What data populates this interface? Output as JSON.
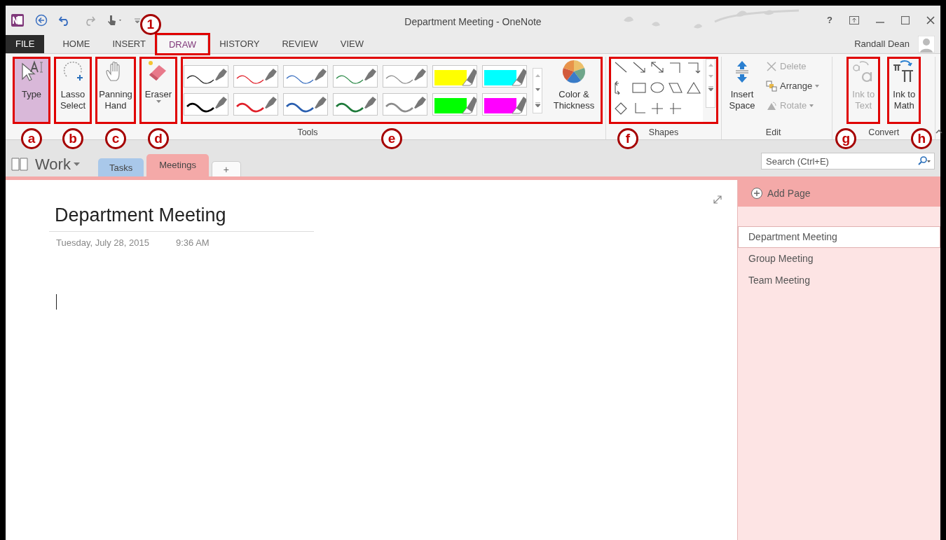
{
  "window": {
    "title": "Department Meeting - OneNote",
    "help_glyph": "?",
    "user": "Randall Dean"
  },
  "ribbon_tabs": [
    {
      "label": "FILE",
      "kind": "file",
      "selected": false
    },
    {
      "label": "HOME",
      "kind": "tab",
      "selected": false
    },
    {
      "label": "INSERT",
      "kind": "tab",
      "selected": false
    },
    {
      "label": "DRAW",
      "kind": "tab",
      "selected": true,
      "callout": "1"
    },
    {
      "label": "HISTORY",
      "kind": "tab",
      "selected": false
    },
    {
      "label": "REVIEW",
      "kind": "tab",
      "selected": false
    },
    {
      "label": "VIEW",
      "kind": "tab",
      "selected": false
    }
  ],
  "tool_buttons": [
    {
      "label": "Type",
      "kind": "type",
      "selected": true,
      "callout": "a"
    },
    {
      "label": "Lasso Select",
      "kind": "lasso",
      "selected": false,
      "callout": "b"
    },
    {
      "label": "Panning Hand",
      "kind": "hand",
      "selected": false,
      "callout": "c"
    },
    {
      "label": "Eraser",
      "kind": "eraser",
      "selected": false,
      "callout": "d"
    }
  ],
  "pens": {
    "callout": "e",
    "items": [
      {
        "kind": "thin",
        "color": "#222222"
      },
      {
        "kind": "thin",
        "color": "#e0202a"
      },
      {
        "kind": "thin",
        "color": "#3a6fc0"
      },
      {
        "kind": "thin",
        "color": "#2e8b4a"
      },
      {
        "kind": "thin",
        "color": "#8c8c8c"
      },
      {
        "kind": "highlighter",
        "color": "#ffff00"
      },
      {
        "kind": "highlighter",
        "color": "#00ffff"
      },
      {
        "kind": "thick",
        "color": "#000000"
      },
      {
        "kind": "thick",
        "color": "#e0202a"
      },
      {
        "kind": "thick",
        "color": "#2a5fb0"
      },
      {
        "kind": "thick",
        "color": "#1e7a3a"
      },
      {
        "kind": "thick",
        "color": "#8c8c8c"
      },
      {
        "kind": "highlighter",
        "color": "#00ff00"
      },
      {
        "kind": "highlighter",
        "color": "#ff00ff"
      }
    ],
    "color_button": "Color & Thickness",
    "group_label": "Tools"
  },
  "shapes": {
    "callout": "f",
    "group_label": "Shapes"
  },
  "edit": {
    "insert_space": "Insert Space",
    "actions": [
      {
        "label": "Delete",
        "kind": "delete",
        "disabled": true
      },
      {
        "label": "Arrange",
        "kind": "arrange",
        "disabled": false
      },
      {
        "label": "Rotate",
        "kind": "rotate",
        "disabled": true
      }
    ],
    "group_label": "Edit"
  },
  "convert": {
    "buttons": [
      {
        "label": "Ink to Text",
        "kind": "text",
        "disabled": true,
        "callout": "g"
      },
      {
        "label": "Ink to Math",
        "kind": "math",
        "disabled": false,
        "callout": "h"
      }
    ],
    "group_label": "Convert"
  },
  "notebook": {
    "name": "Work",
    "sections": [
      {
        "label": "Tasks",
        "color": "#a9c8ea",
        "selected": false
      },
      {
        "label": "Meetings",
        "color": "#f4a9a8",
        "selected": true
      }
    ],
    "add_section": "+"
  },
  "search": {
    "placeholder": "Search (Ctrl+E)"
  },
  "page": {
    "title": "Department Meeting",
    "date": "Tuesday, July 28, 2015",
    "time": "9:36 AM"
  },
  "pages_panel": {
    "add_page": "Add Page",
    "pages": [
      {
        "title": "Department Meeting",
        "selected": true
      },
      {
        "title": "Group Meeting",
        "selected": false
      },
      {
        "title": "Team Meeting",
        "selected": false
      }
    ]
  }
}
